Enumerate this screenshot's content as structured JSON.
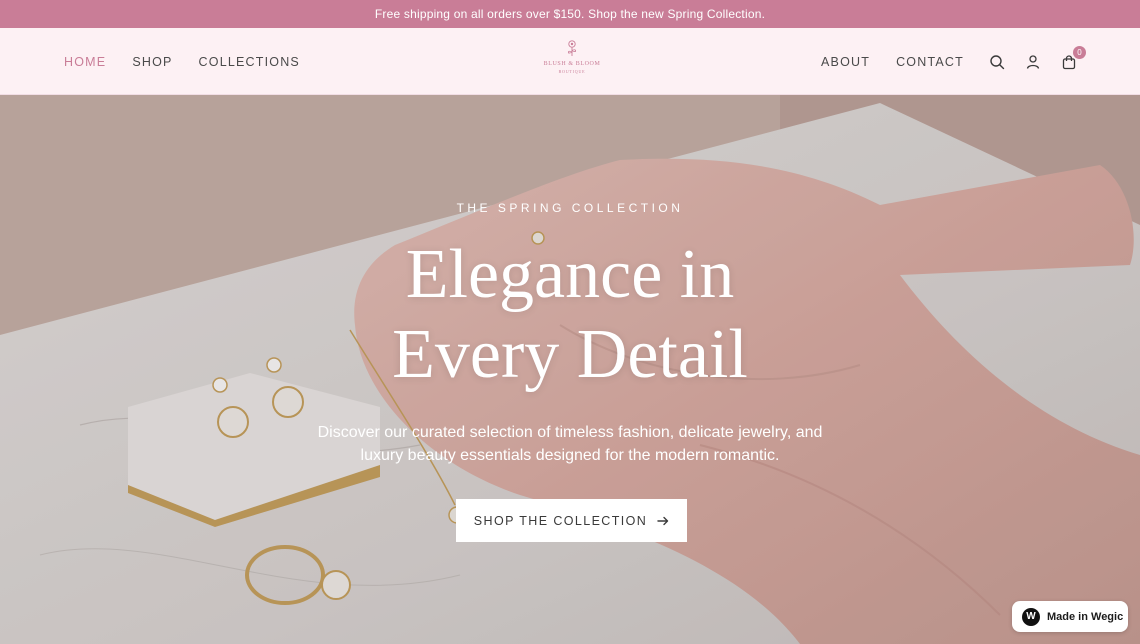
{
  "announcement": "Free shipping on all orders over $150. Shop the new Spring Collection.",
  "nav": {
    "left": [
      {
        "label": "HOME",
        "active": true
      },
      {
        "label": "SHOP",
        "active": false
      },
      {
        "label": "COLLECTIONS",
        "active": false
      }
    ],
    "right": [
      {
        "label": "ABOUT"
      },
      {
        "label": "CONTACT"
      }
    ]
  },
  "logo": {
    "name": "BLUSH & BLOOM",
    "tagline": "BOUTIQUE"
  },
  "icons": {
    "search": "search-icon",
    "account": "user-icon",
    "cart": "shopping-bag-icon",
    "cart_count": "0"
  },
  "hero": {
    "eyebrow": "THE SPRING COLLECTION",
    "headline_line1": "Elegance in",
    "headline_line2": "Every Detail",
    "subtext": "Discover our curated selection of timeless fashion, delicate jewelry, and luxury beauty essentials designed for the modern romantic.",
    "cta_label": "SHOP THE COLLECTION",
    "cta_icon": "arrow-right-icon"
  },
  "made_badge": {
    "label": "Made in Wegic",
    "icon": "wegic-logo-icon"
  },
  "colors": {
    "accent": "#c97d97",
    "header_bg": "#fdf1f4",
    "text_dark": "#4a4a4a",
    "white": "#ffffff"
  }
}
